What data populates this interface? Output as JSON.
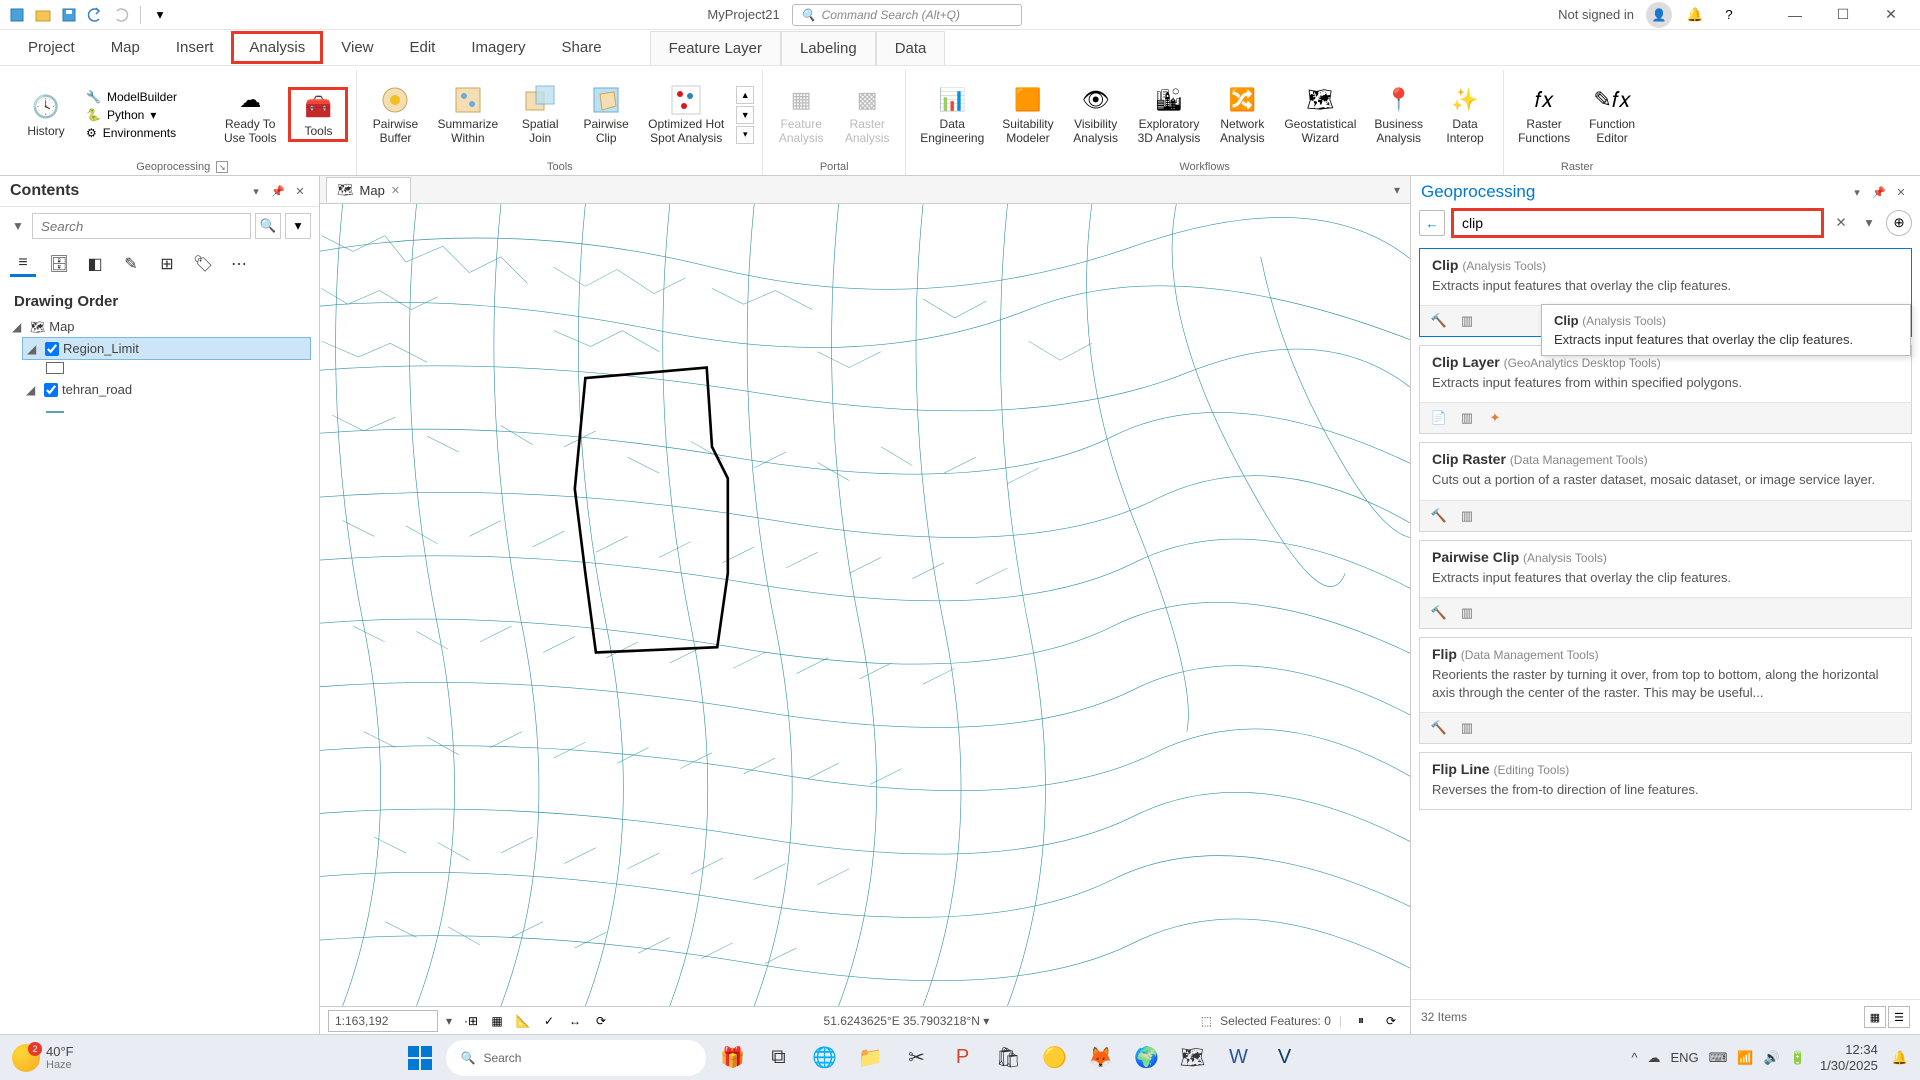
{
  "title_bar": {
    "project_title": "MyProject21",
    "command_search_placeholder": "Command Search (Alt+Q)",
    "signed_in": "Not signed in"
  },
  "ribbon_tabs": [
    "Project",
    "Map",
    "Insert",
    "Analysis",
    "View",
    "Edit",
    "Imagery",
    "Share"
  ],
  "context_tabs": [
    "Feature Layer",
    "Labeling",
    "Data"
  ],
  "active_tab": "Analysis",
  "ribbon": {
    "geoprocessing": {
      "label": "Geoprocessing",
      "history": "History",
      "modelbuilder": "ModelBuilder",
      "python": "Python",
      "environments": "Environments",
      "ready": "Ready To\nUse Tools",
      "tools": "Tools"
    },
    "tools": {
      "label": "Tools",
      "buffer": "Pairwise\nBuffer",
      "summarize": "Summarize\nWithin",
      "spatialjoin": "Spatial\nJoin",
      "clip": "Pairwise\nClip",
      "hotspot": "Optimized Hot\nSpot Analysis"
    },
    "portal": {
      "label": "Portal",
      "feature": "Feature\nAnalysis",
      "raster": "Raster\nAnalysis"
    },
    "workflows": {
      "label": "Workflows",
      "dataeng": "Data\nEngineering",
      "suitability": "Suitability\nModeler",
      "visibility": "Visibility\nAnalysis",
      "exploratory": "Exploratory\n3D Analysis",
      "network": "Network\nAnalysis",
      "geostat": "Geostatistical\nWizard",
      "business": "Business\nAnalysis",
      "interop": "Data\nInterop"
    },
    "raster": {
      "label": "Raster",
      "functions": "Raster\nFunctions",
      "editor": "Function\nEditor"
    }
  },
  "contents": {
    "title": "Contents",
    "search_placeholder": "Search",
    "drawing_order": "Drawing Order",
    "map_name": "Map",
    "layers": [
      {
        "name": "Region_Limit",
        "selected": true
      },
      {
        "name": "tehran_road",
        "selected": false
      }
    ]
  },
  "map_view": {
    "tab_label": "Map",
    "scale": "1:163,192",
    "coords": "51.6243625°E 35.7903218°N",
    "selected_features": "Selected Features: 0"
  },
  "geoprocessing": {
    "title": "Geoprocessing",
    "search_value": "clip",
    "tooltip": {
      "title": "Clip",
      "category": "(Analysis Tools)",
      "desc": "Extracts input features that overlay the clip features."
    },
    "results": [
      {
        "name": "Clip",
        "category": "(Analysis Tools)",
        "desc": "Extracts input features that overlay the clip features.",
        "highlighted": true
      },
      {
        "name": "Clip Layer",
        "category": "(GeoAnalytics Desktop Tools)",
        "desc": "Extracts input features from within specified polygons."
      },
      {
        "name": "Clip Raster",
        "category": "(Data Management Tools)",
        "desc": "Cuts out a portion of a raster dataset, mosaic dataset, or image service layer."
      },
      {
        "name": "Pairwise Clip",
        "category": "(Analysis Tools)",
        "desc": "Extracts input features that overlay the clip features."
      },
      {
        "name": "Flip",
        "category": "(Data Management Tools)",
        "desc": "Reorients the raster by turning it over, from top to bottom, along the horizontal axis through the center of the raster. This may be useful..."
      },
      {
        "name": "Flip Line",
        "category": "(Editing Tools)",
        "desc": "Reverses the from-to direction of line features."
      }
    ],
    "footer_count": "32 Items"
  },
  "taskbar": {
    "weather_temp": "40°F",
    "weather_desc": "Haze",
    "weather_badge": "2",
    "search_placeholder": "Search",
    "lang": "ENG",
    "time": "12:34",
    "date": "1/30/2025"
  }
}
